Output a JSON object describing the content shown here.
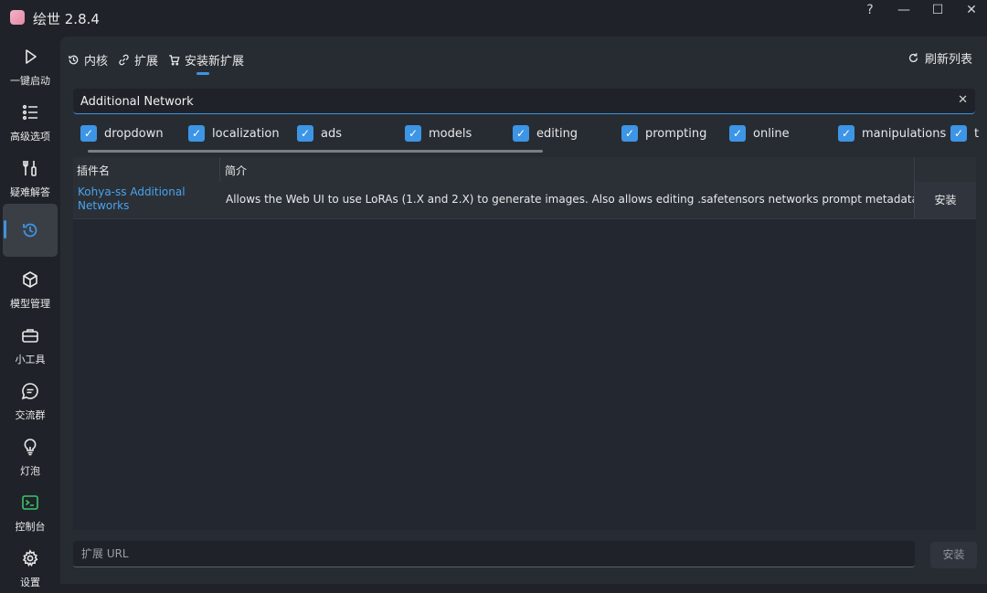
{
  "app": {
    "title": "绘世 2.8.4"
  },
  "window_controls": {
    "help": "?",
    "minimize": "—",
    "maximize": "☐",
    "close": "✕"
  },
  "sidebar": {
    "items": [
      {
        "label": "一键启动",
        "icon": "play-icon"
      },
      {
        "label": "高级选项",
        "icon": "list-icon"
      },
      {
        "label": "疑难解答",
        "icon": "tools-icon"
      },
      {
        "label": "",
        "icon": "history-icon",
        "active": true
      },
      {
        "label": "模型管理",
        "icon": "cube-icon"
      },
      {
        "label": "小工具",
        "icon": "toolbox-icon"
      },
      {
        "label": "交流群",
        "icon": "chat-icon"
      },
      {
        "label": "灯泡",
        "icon": "bulb-icon"
      },
      {
        "label": "控制台",
        "icon": "terminal-icon"
      },
      {
        "label": "设置",
        "icon": "gear-icon"
      }
    ]
  },
  "tabs": [
    {
      "label": "内核",
      "icon": "history-icon"
    },
    {
      "label": "扩展",
      "icon": "link-icon"
    },
    {
      "label": "安装新扩展",
      "icon": "cart-icon",
      "active": true
    }
  ],
  "refresh": {
    "label": "刷新列表",
    "icon": "refresh-icon"
  },
  "search": {
    "value": "Additional Network",
    "clear": "✕"
  },
  "tags": [
    "dropdown",
    "localization",
    "ads",
    "models",
    "editing",
    "prompting",
    "online",
    "manipulations",
    "t"
  ],
  "table": {
    "headers": {
      "name": "插件名",
      "desc": "简介"
    },
    "rows": [
      {
        "name": "Kohya-ss Additional Networks",
        "desc": "Allows the Web UI to use LoRAs (1.X and 2.X) to generate images. Also allows editing .safetensors networks prompt metadata.",
        "action": "安装"
      }
    ]
  },
  "url_input": {
    "placeholder": "扩展 URL",
    "button": "安装"
  },
  "colors": {
    "accent": "#3f93e0",
    "link": "#4aa3ee",
    "terminal_icon": "#3cc46a"
  }
}
